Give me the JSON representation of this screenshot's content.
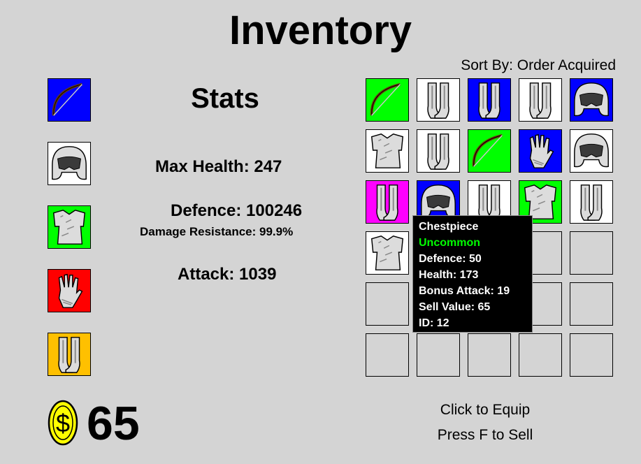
{
  "title": "Inventory",
  "sort_label": "Sort By: Order Acquired",
  "stats": {
    "title": "Stats",
    "max_health": "Max Health: 247",
    "defence": "Defence: 100246",
    "damage_resistance": "Damage Resistance: 99.9%",
    "attack": "Attack: 1039"
  },
  "equipped": [
    {
      "item": "bow-icon",
      "color": "#0000ff"
    },
    {
      "item": "helmet-icon",
      "color": "#ffffff"
    },
    {
      "item": "chestpiece-icon",
      "color": "#00ff00"
    },
    {
      "item": "gauntlet-icon",
      "color": "#ff0000"
    },
    {
      "item": "leggings-icon",
      "color": "#ffc000"
    }
  ],
  "inventory_rows": [
    [
      "bow-icon",
      "leggings-icon",
      "leggings-icon",
      "leggings-icon",
      "helmet-icon"
    ],
    [
      "chestpiece-icon",
      "leggings-icon",
      "bow-icon",
      "gauntlet-icon",
      "helmet-icon"
    ],
    [
      "leggings-icon",
      "helmet-icon",
      "leggings-icon",
      "chestpiece-icon",
      "leggings-icon"
    ],
    [
      "chestpiece-icon",
      "",
      "",
      "",
      ""
    ],
    [
      "",
      "",
      "",
      "",
      ""
    ],
    [
      "",
      "",
      "",
      "",
      ""
    ]
  ],
  "inventory_colors": [
    [
      "#00ff00",
      "#ffffff",
      "#0000ff",
      "#ffffff",
      "#0000ff"
    ],
    [
      "#ffffff",
      "#ffffff",
      "#00ff00",
      "#0000ff",
      "#ffffff"
    ],
    [
      "#ff00ff",
      "#0000ff",
      "#ffffff",
      "#00ff00",
      "#ffffff"
    ],
    [
      "#ffffff",
      "",
      "",
      "",
      ""
    ],
    [
      "",
      "",
      "",
      "",
      ""
    ],
    [
      "",
      "",
      "",
      "",
      ""
    ]
  ],
  "tooltip": {
    "name": "Chestpiece",
    "rarity": "Uncommon",
    "rarity_color": "#00ff00",
    "defence": "Defence: 50",
    "health": "Health: 173",
    "bonus_attack": "Bonus Attack: 19",
    "sell_value": "Sell Value: 65",
    "id": "ID: 12"
  },
  "money": "65",
  "coin_icon": "dollar-coin-icon",
  "hints": {
    "equip": "Click to Equip",
    "sell": "Press F to Sell"
  }
}
